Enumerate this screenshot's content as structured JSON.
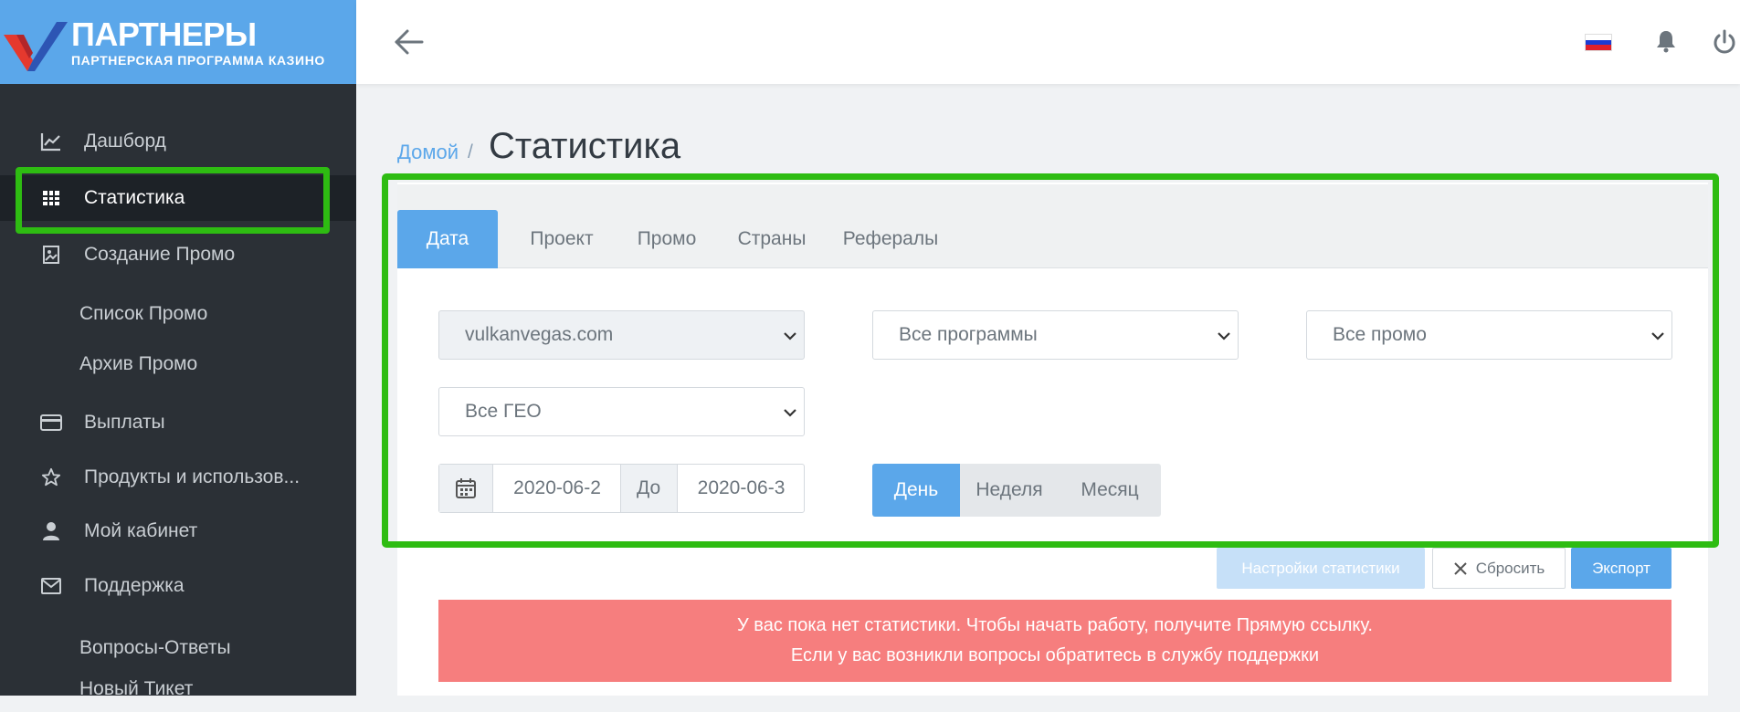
{
  "brand": {
    "title": "ПАРТНЕРЫ",
    "subtitle": "ПАРТНЕРСКАЯ ПРОГРАММА КАЗИНО",
    "color": "#5ba7ea"
  },
  "sidebar": {
    "items": [
      {
        "label": "Дашборд",
        "icon": "chart-line-icon"
      },
      {
        "label": "Статистика",
        "icon": "grid-icon",
        "active": true
      },
      {
        "label": "Создание Промо",
        "icon": "image-icon"
      },
      {
        "label": "Список Промо"
      },
      {
        "label": "Архив Промо"
      },
      {
        "label": "Выплаты",
        "icon": "credit-card-icon"
      },
      {
        "label": "Продукты и использов...",
        "icon": "star-icon"
      },
      {
        "label": "Мой кабинет",
        "icon": "user-icon"
      },
      {
        "label": "Поддержка",
        "icon": "envelope-icon"
      },
      {
        "label": "Вопросы-Ответы"
      },
      {
        "label": "Новый Тикет"
      }
    ]
  },
  "header": {
    "back_icon": "arrow-left-icon",
    "language_flag": "russia-flag-icon",
    "notifications_icon": "bell-icon",
    "logout_icon": "power-icon"
  },
  "breadcrumb": {
    "home": "Домой",
    "separator": "/",
    "current": "Статистика"
  },
  "tabs": [
    "Дата",
    "Проект",
    "Промо",
    "Страны",
    "Рефералы"
  ],
  "filters": {
    "site": "vulkanvegas.com",
    "programs": "Все программы",
    "promo": "Все промо",
    "geo": "Все ГЕО",
    "date_from": "2020-06-2",
    "date_to_label": "До",
    "date_to": "2020-06-3",
    "calendar_icon": "calendar-icon"
  },
  "period": [
    "День",
    "Неделя",
    "Месяц"
  ],
  "actions": {
    "settings": "Настройки статистики",
    "reset": "Сбросить",
    "reset_icon": "close-icon",
    "export": "Экспорт"
  },
  "alert": {
    "line1": "У вас пока нет статистики. Чтобы начать работу, получите Прямую ссылку.",
    "line2": "Если у вас возникли вопросы обратитесь в службу поддержки"
  },
  "colors": {
    "highlight": "#2ebc12",
    "accent": "#5ba7ea",
    "alert": "#f67e7e",
    "sidebar": "#2b3036"
  }
}
